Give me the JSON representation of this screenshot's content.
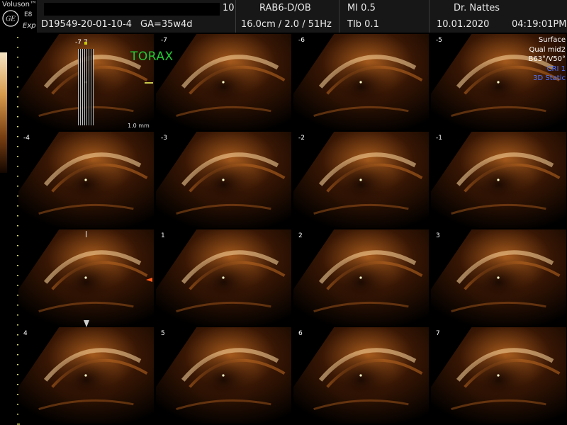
{
  "header": {
    "brand": "Voluson™",
    "model": "E8",
    "preset_mode": "Exp",
    "ge_logo_icon": "ge-monogram-icon",
    "field_index": "10",
    "probe": "RAB6-D/OB",
    "mi": "MI 0.5",
    "doctor": "Dr. Nattes",
    "patient_id": "D19549-20-01-10-4",
    "gestational_age": "GA=35w4d",
    "depth_settings": "16.0cm / 2.0 / 51Hz",
    "tib": "TIb 0.1",
    "date": "10.01.2020",
    "time": "04:19:01PM"
  },
  "overlay": {
    "region_label": "TORAX",
    "slice_range": "-7   7",
    "thumb_scale": "1.0 mm",
    "info_lines": [
      {
        "text": "Surface",
        "color": "#ffffff"
      },
      {
        "text": "Qual mid2",
        "color": "#ffffff"
      },
      {
        "text": "B63°/V50°",
        "color": "#ffffff"
      },
      {
        "text": "CRI 1",
        "color": "#4d74ff"
      },
      {
        "text": "3D Static",
        "color": "#4d74ff"
      }
    ]
  },
  "slices": [
    {
      "label": ""
    },
    {
      "label": "-7"
    },
    {
      "label": "-6"
    },
    {
      "label": "-5"
    },
    {
      "label": "-4"
    },
    {
      "label": "-3"
    },
    {
      "label": "-2"
    },
    {
      "label": "-1"
    },
    {
      "label": ""
    },
    {
      "label": "1"
    },
    {
      "label": "2"
    },
    {
      "label": "3"
    },
    {
      "label": "4"
    },
    {
      "label": "5"
    },
    {
      "label": "6"
    },
    {
      "label": "7"
    }
  ],
  "colors": {
    "tint_bright": "#ffd9a0",
    "tint_mid": "#b3621f",
    "tint_dark": "#3a1704",
    "marker_green": "#22cc33",
    "accent_blue": "#4d74ff",
    "orange_marker": "#ff5a1a"
  }
}
